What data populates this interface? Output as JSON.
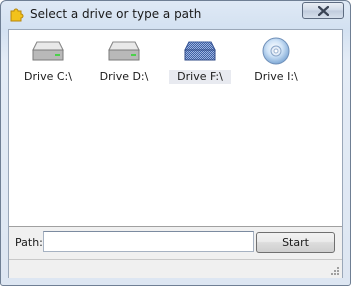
{
  "window": {
    "title": "Select a drive or type a path"
  },
  "icons": {
    "app": "puzzle-icon",
    "close": "close-icon",
    "hard_drive": "hard-drive-icon",
    "removable_drive": "removable-drive-icon",
    "optical_drive": "cd-drive-icon",
    "resize_grip": "resize-grip-icon"
  },
  "drives": [
    {
      "label": "Drive C:\\",
      "icon": "hard-drive-icon",
      "selected": false
    },
    {
      "label": "Drive D:\\",
      "icon": "hard-drive-icon",
      "selected": false
    },
    {
      "label": "Drive F:\\",
      "icon": "removable-drive-icon",
      "selected": true
    },
    {
      "label": "Drive I:\\",
      "icon": "cd-drive-icon",
      "selected": false
    }
  ],
  "path": {
    "label": "Path:",
    "value": "",
    "placeholder": ""
  },
  "buttons": {
    "start": "Start"
  },
  "colors": {
    "close_x": "#e8eef6",
    "selection": "#e8eaf0",
    "frame": "#dae5f3"
  }
}
